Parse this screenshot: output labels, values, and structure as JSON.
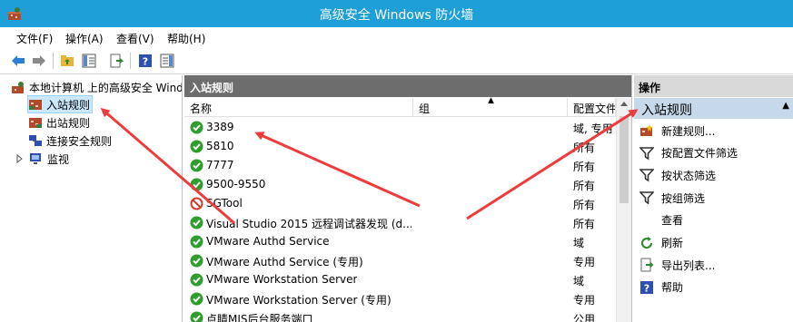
{
  "window": {
    "title": "高级安全 Windows 防火墙"
  },
  "menu": [
    "文件(F)",
    "操作(A)",
    "查看(V)",
    "帮助(H)"
  ],
  "tree": {
    "root": "本地计算机 上的高级安全 Windows 防火墙",
    "inbound": "入站规则",
    "outbound": "出站规则",
    "connection": "连接安全规则",
    "monitor": "监视"
  },
  "center": {
    "header": "入站规则",
    "columns": {
      "name": "名称",
      "group": "组",
      "profile": "配置文件"
    },
    "rows": [
      {
        "name": "3389",
        "profile": "域, 专用",
        "status": "allow"
      },
      {
        "name": "5810",
        "profile": "所有",
        "status": "allow"
      },
      {
        "name": "7777",
        "profile": "所有",
        "status": "allow"
      },
      {
        "name": "9500-9550",
        "profile": "所有",
        "status": "allow"
      },
      {
        "name": "SGTool",
        "profile": "所有",
        "status": "block"
      },
      {
        "name": "Visual Studio 2015 远程调试器发现 (d...",
        "profile": "所有",
        "status": "allow"
      },
      {
        "name": "VMware Authd Service",
        "profile": "域",
        "status": "allow"
      },
      {
        "name": "VMware Authd Service (专用)",
        "profile": "专用",
        "status": "allow"
      },
      {
        "name": "VMware Workstation Server",
        "profile": "域",
        "status": "allow"
      },
      {
        "name": "VMware Workstation Server (专用)",
        "profile": "专用",
        "status": "allow"
      },
      {
        "name": "点睛MIS后台服务端口",
        "profile": "公用",
        "status": "allow"
      }
    ]
  },
  "actions": {
    "header": "操作",
    "section": "入站规则",
    "items": [
      {
        "label": "新建规则...",
        "icon": "new-rule-icon"
      },
      {
        "label": "按配置文件筛选",
        "icon": "filter-icon"
      },
      {
        "label": "按状态筛选",
        "icon": "filter-icon"
      },
      {
        "label": "按组筛选",
        "icon": "filter-icon"
      },
      {
        "label": "查看",
        "icon": ""
      },
      {
        "label": "刷新",
        "icon": "refresh-icon"
      },
      {
        "label": "导出列表...",
        "icon": "export-icon"
      },
      {
        "label": "帮助",
        "icon": "help-icon"
      }
    ]
  },
  "colors": {
    "titlebar": "#1e9fd8",
    "pane_header": "#6d6d6d",
    "section_header": "#c5d9ea",
    "allow_green": "#2f9e2f",
    "block_red": "#d83b2b",
    "annotation_arrow": "#ee3b3b"
  }
}
